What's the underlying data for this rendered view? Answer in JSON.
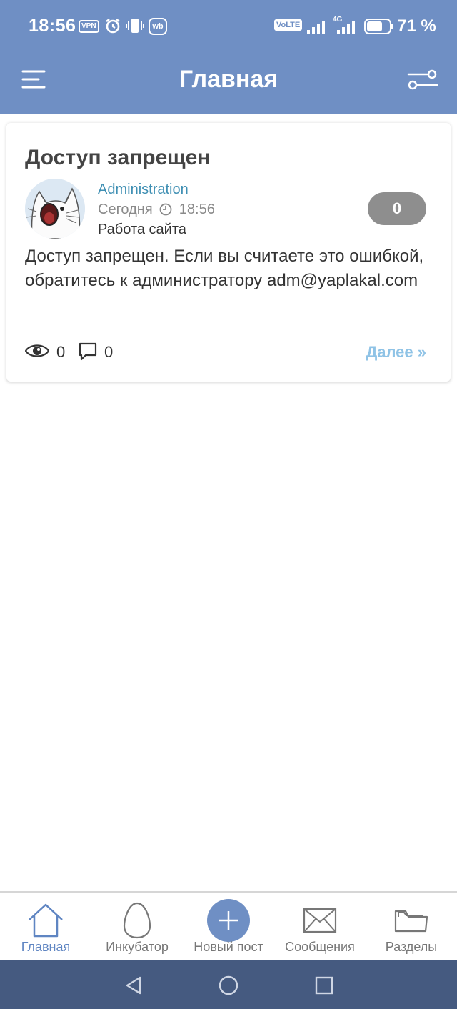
{
  "status_bar": {
    "time": "18:56",
    "vpn": "VPN",
    "wb": "wb",
    "volte": "VoLTE",
    "sim1": "1\n2",
    "network": "4G",
    "battery_percent": "71 %",
    "battery_level": 0.71
  },
  "header": {
    "title": "Главная",
    "bg_color": "#6f8fc4"
  },
  "post": {
    "title": "Доступ запрещен",
    "author": "Administration",
    "date": "Сегодня",
    "time": "18:56",
    "category": "Работа сайта",
    "rating": "0",
    "body": "Доступ запрещен. Если вы считаете это ошибкой, обратитесь к администратору adm@yaplakal.com",
    "views": "0",
    "comments": "0",
    "more_label": "Далее »"
  },
  "bottom_nav": {
    "items": [
      {
        "label": "Главная",
        "icon": "home-icon",
        "active": true
      },
      {
        "label": "Инкубатор",
        "icon": "egg-icon",
        "active": false
      },
      {
        "label": "Новый пост",
        "icon": "plus-icon",
        "active": false
      },
      {
        "label": "Сообщения",
        "icon": "envelope-icon",
        "active": false
      },
      {
        "label": "Разделы",
        "icon": "folder-icon",
        "active": false
      }
    ]
  },
  "system_nav": {
    "buttons": [
      "back-icon",
      "home-circle-icon",
      "recents-icon"
    ]
  }
}
